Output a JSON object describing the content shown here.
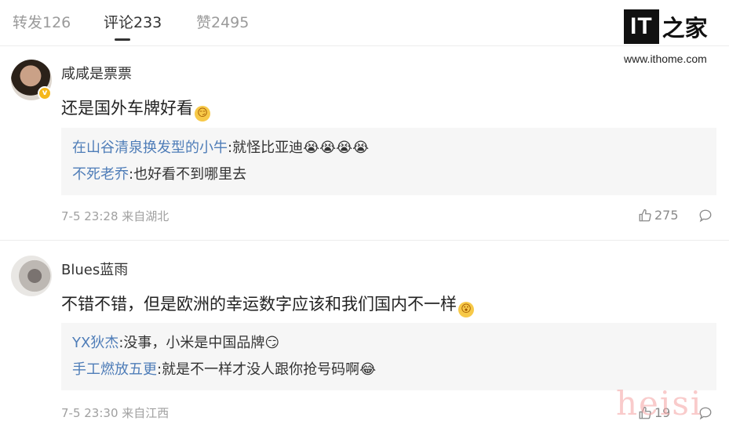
{
  "tabs": [
    {
      "label": "转发126"
    },
    {
      "label": "评论233"
    },
    {
      "label": "赞2495"
    }
  ],
  "brand": {
    "logo_it": "IT",
    "logo_cn": "之家",
    "url": "www.ithome.com"
  },
  "comments": [
    {
      "username": "咸咸是票票",
      "content": "还是国外车牌好看",
      "content_emoji": "😏",
      "replies": [
        {
          "name": "在山谷清泉换发型的小牛",
          "sep": ":",
          "text": "就怪比亚迪",
          "emoji": "😭😭😭😭"
        },
        {
          "name": "不死老乔",
          "sep": ":",
          "text": "也好看不到哪里去",
          "emoji": ""
        }
      ],
      "time": "7-5 23:28 来自湖北",
      "likes": "275"
    },
    {
      "username": "Blues蓝雨",
      "content": "不错不错，但是欧洲的幸运数字应该和我们国内不一样",
      "content_emoji": "😮",
      "replies": [
        {
          "name": "YX狄杰",
          "sep": ":",
          "text": "没事，小米是中国品牌",
          "emoji": "😏"
        },
        {
          "name": "手工燃放五更",
          "sep": ":",
          "text": "就是不一样才没人跟你抢号码啊",
          "emoji": "😂"
        }
      ],
      "time": "7-5 23:30 来自江西",
      "likes": "19"
    }
  ],
  "watermark": "heisi",
  "colors": {
    "link": "#4f7db8",
    "meta": "#a0a0a0",
    "reply_bg": "#f6f6f6",
    "badge": "#f5b81c"
  },
  "icons": {
    "like": "thumbs-up-icon",
    "comment": "comment-bubble-icon",
    "verified": "verified-badge-icon"
  }
}
